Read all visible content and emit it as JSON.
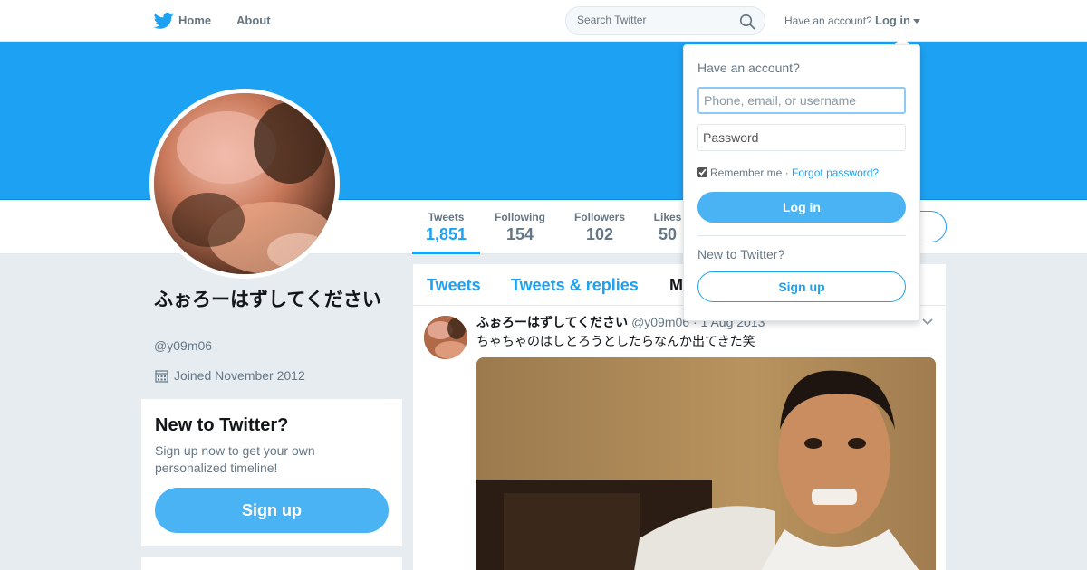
{
  "colors": {
    "brand": "#1da1f2",
    "button": "#4ab3f4",
    "background": "#e6ecf0"
  },
  "nav": {
    "logo_icon": "twitter-bird-icon",
    "home_label": "Home",
    "about_label": "About",
    "search_placeholder": "Search Twitter",
    "search_icon": "magnifier-icon",
    "have_account": "Have an account?",
    "login_label": "Log in"
  },
  "profile": {
    "display_name": "ふぉろーはずしてください",
    "screen_name": "@y09m06",
    "joined": "Joined November 2012"
  },
  "stats": [
    {
      "label": "Tweets",
      "value": "1,851"
    },
    {
      "label": "Following",
      "value": "154"
    },
    {
      "label": "Followers",
      "value": "102"
    },
    {
      "label": "Likes",
      "value": "50"
    }
  ],
  "signup_card": {
    "title": "New to Twitter?",
    "text": "Sign up now to get your own personalized timeline!",
    "button": "Sign up"
  },
  "timeline": {
    "tabs": [
      "Tweets",
      "Tweets & replies",
      "M"
    ],
    "tweet": {
      "name": "ふぉろーはずしてください",
      "handle": "@y09m06",
      "date": "· 1 Aug 2013",
      "text": "ちゃちゃのはしとろうとしたらなんか出てきた笑"
    }
  },
  "login_dropdown": {
    "title": "Have an account?",
    "username_placeholder": "Phone, email, or username",
    "password_placeholder": "Password",
    "remember_me": "Remember me",
    "separator": "·",
    "forgot": "Forgot password?",
    "login_button": "Log in",
    "new_to_twitter": "New to Twitter?",
    "signup_button": "Sign up"
  }
}
